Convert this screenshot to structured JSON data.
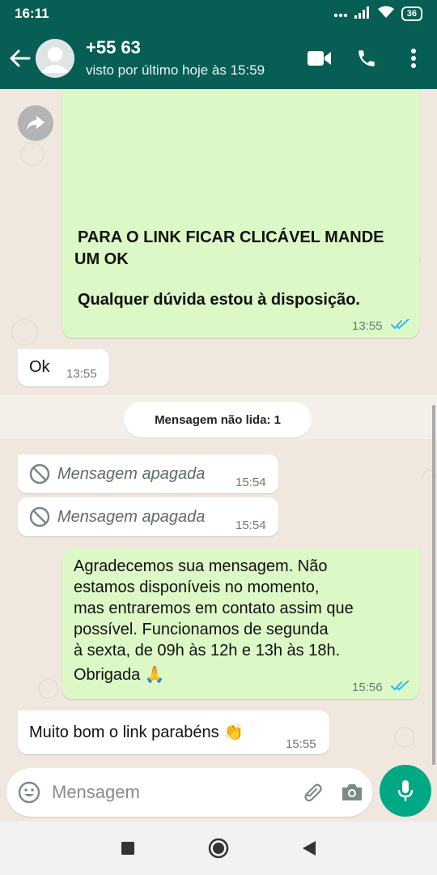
{
  "status_bar": {
    "time": "16:11",
    "battery": "36"
  },
  "header": {
    "contact_name": "+55 63",
    "last_seen": "visto por último hoje às 15:59"
  },
  "messages": [
    {
      "direction": "out",
      "lines": [
        "PARA O LINK FICAR CLICÁVEL MANDE",
        "UM OK",
        "Qualquer dúvida estou à disposição."
      ],
      "time": "13:55"
    },
    {
      "direction": "in",
      "text": "Ok",
      "time": "13:55"
    },
    {
      "direction": "in",
      "deleted": true,
      "text": "Mensagem apagada",
      "time": "15:54"
    },
    {
      "direction": "in",
      "deleted": true,
      "text": "Mensagem apagada",
      "time": "15:54"
    },
    {
      "direction": "out",
      "lines": [
        "Agradecemos sua mensagem. Não",
        "estamos disponíveis no momento,",
        "mas entraremos em contato assim que",
        "possível. Funcionamos de segunda",
        "à sexta, de 09h às 12h e 13h às 18h.",
        "Obrigada 🙏"
      ],
      "time": "15:56"
    },
    {
      "direction": "in",
      "text": "Muito bom o link parabéns 👏",
      "time": "15:55"
    }
  ],
  "unread_banner": "Mensagem não lida: 1",
  "composer": {
    "placeholder": "Mensagem"
  },
  "colors": {
    "header": "#075e54",
    "outgoing_bubble": "#dcf8c6",
    "incoming_bubble": "#ffffff",
    "read_ticks": "#34b7f1",
    "mic_button": "#00a884"
  }
}
